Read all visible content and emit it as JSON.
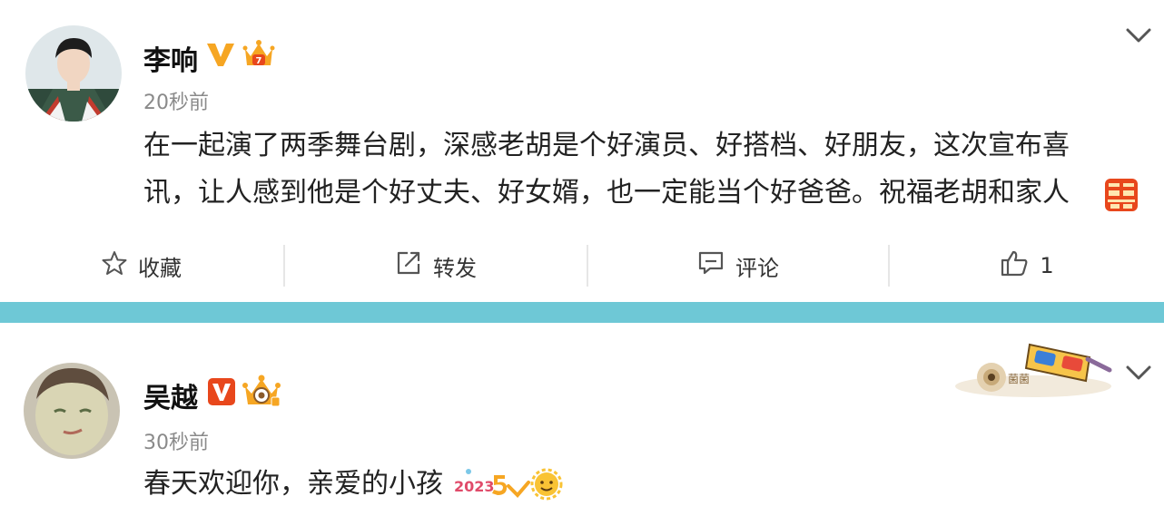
{
  "posts": [
    {
      "author": "李响",
      "time": "20秒前",
      "text_line1": "在一起演了两季舞台剧，深感老胡是个好演员、好搭档、好朋友，这次宣布喜",
      "text_line2": "讯，让人感到他是个好丈夫、好女婿，也一定能当个好爸爸。祝福老胡和家人",
      "actions": {
        "collect": "收藏",
        "repost": "转发",
        "comment": "评论",
        "like_count": "1"
      }
    },
    {
      "author": "吴越",
      "time": "30秒前",
      "text": "春天欢迎你，亲爱的小孩"
    }
  ],
  "icons": {
    "verified": "verified-v-icon",
    "level_badge": "crown-badge-icon",
    "chevron": "chevron-down-icon",
    "double_happiness": "double-happiness-emoji",
    "glasses": "3d-glasses-sticker"
  },
  "colors": {
    "accent_orange": "#f6a623",
    "verified_red": "#e8471c",
    "divider_band": "#6ec8d6",
    "time_gray": "#8a8a8a"
  }
}
